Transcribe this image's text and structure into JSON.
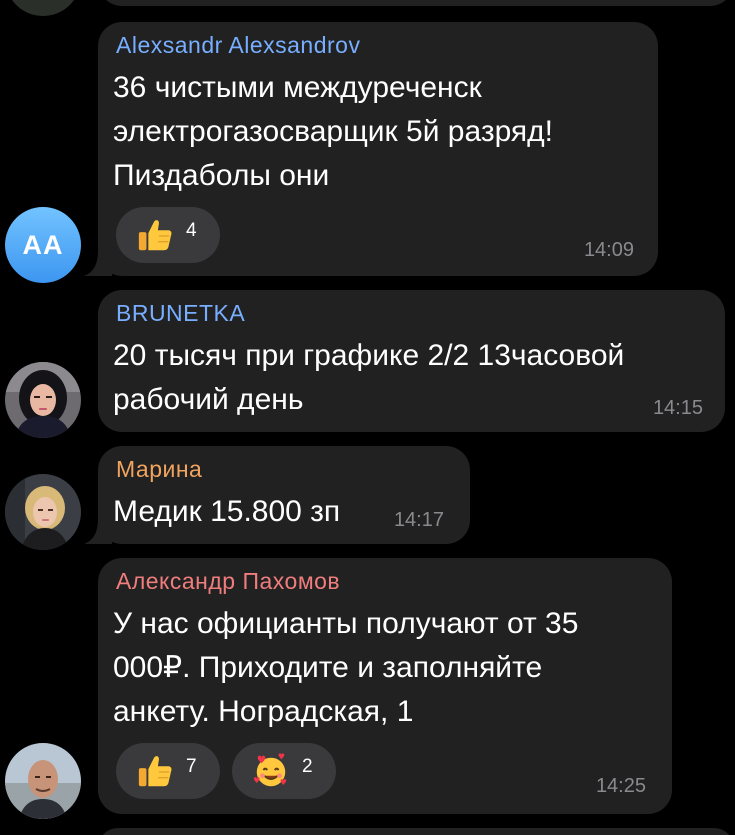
{
  "colors": {
    "background": "#000000",
    "bubble": "#212121",
    "reaction_pill": "#3a3a3c",
    "name_blue": "#78aeff",
    "name_orange": "#f1a45f",
    "name_red": "#f07d7d",
    "time": "#8a8a8e"
  },
  "messages": [
    {
      "sender": "Alexsandr Alexsandrov",
      "sender_color": "#78aeff",
      "text": "36 чистыми междуреченск\nэлектрогазосварщик 5й разряд!\nПиздаболы они",
      "time": "14:09",
      "avatar": {
        "type": "initials",
        "initials": "AA"
      },
      "reactions": [
        {
          "emoji": "thumbs-up",
          "count": "4"
        }
      ]
    },
    {
      "sender": "BRUNETKA",
      "sender_color": "#78aeff",
      "text": "20 тысяч при графике 2/2 13часовой\nрабочий день",
      "time": "14:15",
      "avatar": {
        "type": "photo",
        "icon": "woman-dark-hair-photo"
      },
      "reactions": []
    },
    {
      "sender": "Марина",
      "sender_color": "#f1a45f",
      "text": "Медик 15.800 зп",
      "time": "14:17",
      "avatar": {
        "type": "photo",
        "icon": "woman-blonde-photo"
      },
      "reactions": []
    },
    {
      "sender": "Александр Пахомов",
      "sender_color": "#f07d7d",
      "text": "У нас официанты получают от 35\n000₽. Приходите и заполняйте\nанкету. Ноградская, 1",
      "time": "14:25",
      "avatar": {
        "type": "photo",
        "icon": "man-bald-photo"
      },
      "reactions": [
        {
          "emoji": "thumbs-up",
          "count": "7"
        },
        {
          "emoji": "smiling-face-with-hearts",
          "count": "2"
        }
      ]
    }
  ]
}
